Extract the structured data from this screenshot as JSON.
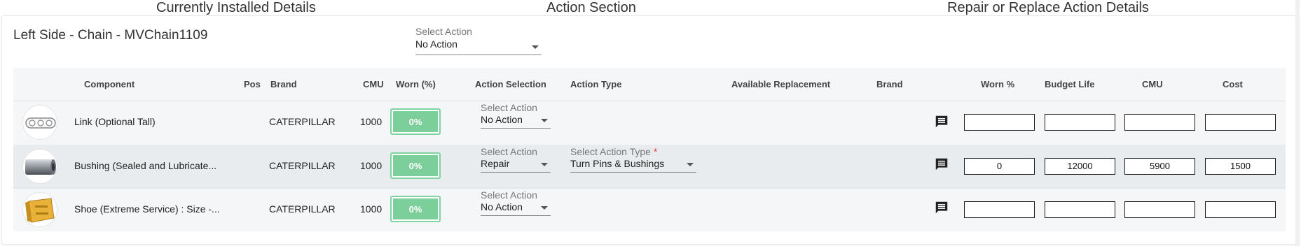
{
  "header": {
    "installed_title": "Currently Installed Details",
    "action_title": "Action Section",
    "repair_title": "Repair or Replace Action Details"
  },
  "chain": {
    "title": "Left Side - Chain - MVChain1109",
    "global_action_label": "Select Action",
    "global_action_value": "No Action"
  },
  "table": {
    "headers": {
      "component": "Component",
      "pos": "Pos",
      "brand": "Brand",
      "cmu": "CMU",
      "worn": "Worn (%)",
      "action_selection": "Action Selection",
      "action_type": "Action Type",
      "available_replacement": "Available Replacement",
      "replacement_brand": "Brand",
      "worn_pct": "Worn %",
      "budget_life": "Budget Life",
      "repair_cmu": "CMU",
      "cost": "Cost"
    },
    "rows": [
      {
        "component": "Link (Optional Tall)",
        "pos": "",
        "brand": "CATERPILLAR",
        "cmu": "1000",
        "worn": "0%",
        "action_label": "Select Action",
        "action_value": "No Action",
        "action_type_label": "",
        "action_type_value": "",
        "worn_pct": "",
        "budget_life": "",
        "repair_cmu": "",
        "cost": ""
      },
      {
        "component": "Bushing (Sealed and Lubricate...",
        "pos": "",
        "brand": "CATERPILLAR",
        "cmu": "1000",
        "worn": "0%",
        "action_label": "Select Action",
        "action_value": "Repair",
        "action_type_label": "Select Action Type",
        "action_type_required": "*",
        "action_type_value": "Turn Pins & Bushings",
        "worn_pct": "0",
        "budget_life": "12000",
        "repair_cmu": "5900",
        "cost": "1500"
      },
      {
        "component": "Shoe (Extreme Service) : Size -...",
        "pos": "",
        "brand": "CATERPILLAR",
        "cmu": "1000",
        "worn": "0%",
        "action_label": "Select Action",
        "action_value": "No Action",
        "action_type_label": "",
        "action_type_value": "",
        "worn_pct": "",
        "budget_life": "",
        "repair_cmu": "",
        "cost": ""
      }
    ]
  },
  "icons": {
    "comment": "comment-icon",
    "link_thumb": "track-link-image",
    "bushing_thumb": "bushing-image",
    "shoe_thumb": "track-shoe-image",
    "dropdown": "chevron-down-icon"
  },
  "colors": {
    "worn_fill": "#7ccf9a",
    "worn_border": "#7ed3a0",
    "required": "#e53935",
    "alt_row": "#e9ecee",
    "table_bg": "#f4f6f7"
  }
}
